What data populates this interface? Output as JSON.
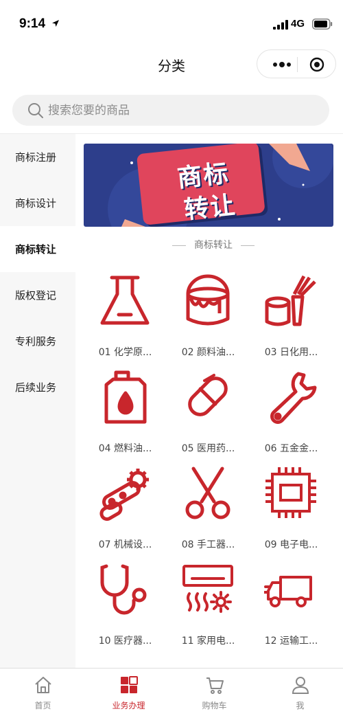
{
  "status_bar": {
    "time": "9:14",
    "network": "4G"
  },
  "nav": {
    "title": "分类"
  },
  "search": {
    "placeholder": "搜索您要的商品"
  },
  "sidebar": {
    "items": [
      {
        "label": "商标注册"
      },
      {
        "label": "商标设计"
      },
      {
        "label": "商标转让"
      },
      {
        "label": "版权登记"
      },
      {
        "label": "专利服务"
      },
      {
        "label": "后续业务"
      }
    ],
    "active_index": 2
  },
  "banner": {
    "line1": "商标",
    "line2": "转让"
  },
  "section": {
    "title": "商标转让"
  },
  "categories": [
    {
      "label": "01 化学原...",
      "icon": "flask-icon"
    },
    {
      "label": "02 颜料油...",
      "icon": "paint-bucket-icon"
    },
    {
      "label": "03 日化用...",
      "icon": "cosmetics-icon"
    },
    {
      "label": "04 燃料油...",
      "icon": "oil-canister-icon"
    },
    {
      "label": "05 医用药...",
      "icon": "capsule-pill-icon"
    },
    {
      "label": "06 五金金...",
      "icon": "wrench-icon"
    },
    {
      "label": "07 机械设...",
      "icon": "gear-chain-icon"
    },
    {
      "label": "08 手工器...",
      "icon": "scissors-icon"
    },
    {
      "label": "09 电子电...",
      "icon": "chip-icon"
    },
    {
      "label": "10 医疗器...",
      "icon": "stethoscope-icon"
    },
    {
      "label": "11 家用电...",
      "icon": "air-conditioner-icon"
    },
    {
      "label": "12 运输工...",
      "icon": "truck-icon"
    }
  ],
  "tabbar": {
    "items": [
      {
        "label": "首页",
        "icon": "home-icon"
      },
      {
        "label": "业务办理",
        "icon": "grid-apps-icon"
      },
      {
        "label": "购物车",
        "icon": "cart-icon"
      },
      {
        "label": "我",
        "icon": "user-icon"
      }
    ],
    "active_index": 1
  },
  "colors": {
    "accent": "#c8262c",
    "banner_bg": "#2d3e8b",
    "banner_card": "#e0455c"
  }
}
